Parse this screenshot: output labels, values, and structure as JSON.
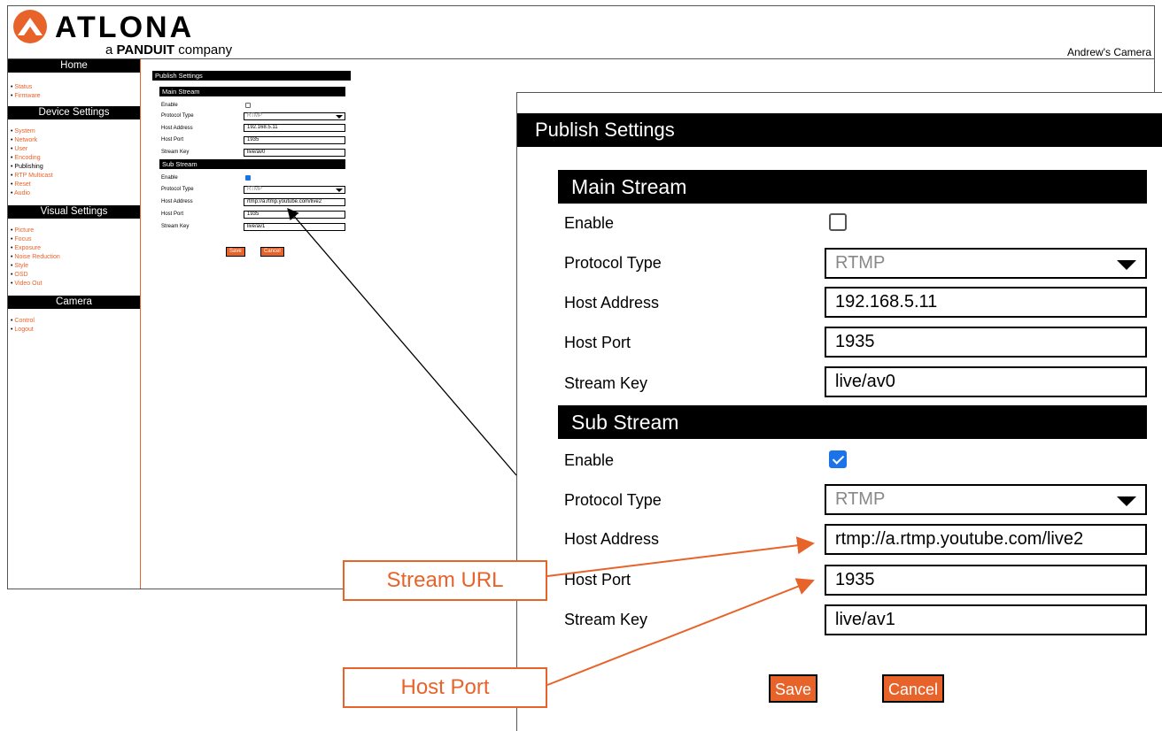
{
  "header": {
    "brand": "ATLONA",
    "tagline_prefix": "a",
    "tagline_company": "PANDUIT",
    "tagline_suffix": "company",
    "camera_name": "Andrew's Camera"
  },
  "sidebar": {
    "sections": [
      {
        "title": "Home",
        "items": [
          "Status",
          "Firmware"
        ]
      },
      {
        "title": "Device Settings",
        "items": [
          "System",
          "Network",
          "User",
          "Encoding",
          "Publishing",
          "RTP Multicast",
          "Reset",
          "Audio"
        ]
      },
      {
        "title": "Visual Settings",
        "items": [
          "Picture",
          "Focus",
          "Exposure",
          "Noise Reduction",
          "Style",
          "OSD",
          "Video Out"
        ]
      },
      {
        "title": "Camera",
        "items": [
          "Control",
          "Logout"
        ]
      }
    ],
    "active_item": "Publishing"
  },
  "publish": {
    "title": "Publish Settings",
    "main": {
      "heading": "Main Stream",
      "enable_label": "Enable",
      "enabled": false,
      "protocol_label": "Protocol Type",
      "protocol": "RTMP",
      "host_address_label": "Host Address",
      "host_address": "192.168.5.11",
      "host_port_label": "Host Port",
      "host_port": "1935",
      "stream_key_label": "Stream Key",
      "stream_key": "live/av0"
    },
    "sub": {
      "heading": "Sub Stream",
      "enable_label": "Enable",
      "enabled": true,
      "protocol_label": "Protocol Type",
      "protocol": "RTMP",
      "host_address_label": "Host Address",
      "host_address": "rtmp://a.rtmp.youtube.com/live2",
      "host_port_label": "Host Port",
      "host_port": "1935",
      "stream_key_label": "Stream Key",
      "stream_key": "live/av1"
    },
    "save_label": "Save",
    "cancel_label": "Cancel"
  },
  "callouts": {
    "stream_url": "Stream URL",
    "host_port": "Host Port"
  },
  "colors": {
    "accent": "#e8632a",
    "bar": "#000000",
    "checkbox": "#1a73e8"
  }
}
